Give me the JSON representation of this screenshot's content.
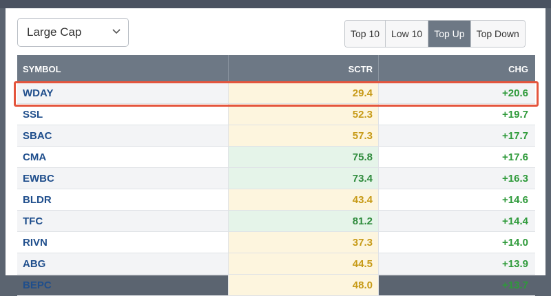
{
  "filter": {
    "selected": "Large Cap"
  },
  "tabs": [
    {
      "label": "Top 10",
      "active": false
    },
    {
      "label": "Low 10",
      "active": false
    },
    {
      "label": "Top Up",
      "active": true
    },
    {
      "label": "Top Down",
      "active": false
    }
  ],
  "table": {
    "headers": {
      "symbol": "SYMBOL",
      "sctr": "SCTR",
      "chg": "CHG"
    },
    "rows": [
      {
        "symbol": "WDAY",
        "sctr": "29.4",
        "chg": "+20.6",
        "sctr_color": "yellow",
        "highlighted": true
      },
      {
        "symbol": "SSL",
        "sctr": "52.3",
        "chg": "+19.7",
        "sctr_color": "yellow",
        "highlighted": false
      },
      {
        "symbol": "SBAC",
        "sctr": "57.3",
        "chg": "+17.7",
        "sctr_color": "yellow",
        "highlighted": false
      },
      {
        "symbol": "CMA",
        "sctr": "75.8",
        "chg": "+17.6",
        "sctr_color": "green",
        "highlighted": false
      },
      {
        "symbol": "EWBC",
        "sctr": "73.4",
        "chg": "+16.3",
        "sctr_color": "green",
        "highlighted": false
      },
      {
        "symbol": "BLDR",
        "sctr": "43.4",
        "chg": "+14.6",
        "sctr_color": "yellow",
        "highlighted": false
      },
      {
        "symbol": "TFC",
        "sctr": "81.2",
        "chg": "+14.4",
        "sctr_color": "green",
        "highlighted": false
      },
      {
        "symbol": "RIVN",
        "sctr": "37.3",
        "chg": "+14.0",
        "sctr_color": "yellow",
        "highlighted": false
      },
      {
        "symbol": "ABG",
        "sctr": "44.5",
        "chg": "+13.9",
        "sctr_color": "yellow",
        "highlighted": false
      },
      {
        "symbol": "BEPC",
        "sctr": "48.0",
        "chg": "+13.7",
        "sctr_color": "yellow",
        "highlighted": false
      }
    ]
  },
  "colors": {
    "header_bg": "#6d7885",
    "symbol": "#1f4e8c",
    "change_positive": "#2e9a3a",
    "sctr_yellow_bg": "#fdf5de",
    "sctr_green_bg": "#e5f4e9",
    "highlight_border": "#e4553d"
  }
}
